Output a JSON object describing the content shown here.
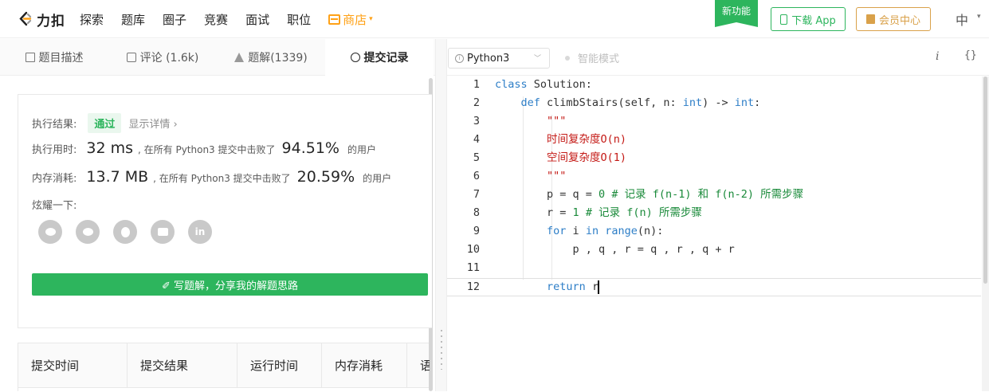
{
  "nav": {
    "logo_text": "力扣",
    "links": [
      "探索",
      "题库",
      "圈子",
      "竞赛",
      "面试",
      "职位"
    ],
    "shop": "商店",
    "new_feature": "新功能",
    "download_app": "下载 App",
    "vip": "会员中心",
    "lang": "中"
  },
  "left_tabs": [
    {
      "label": "题目描述",
      "icon": "description-icon"
    },
    {
      "label": "评论 (1.6k)",
      "icon": "comment-icon"
    },
    {
      "label": "题解(1339)",
      "icon": "flask-icon"
    },
    {
      "label": "提交记录",
      "icon": "clock-icon",
      "active": true
    }
  ],
  "result": {
    "status_label": "执行结果:",
    "status": "通过",
    "detail": "显示详情 ›",
    "runtime_label": "执行用时:",
    "runtime": "32 ms",
    "runtime_mid": ", 在所有 Python3 提交中击败了",
    "runtime_pct": "94.51%",
    "runtime_tail": "的用户",
    "memory_label": "内存消耗:",
    "memory": "13.7 MB",
    "memory_mid": ", 在所有 Python3 提交中击败了",
    "memory_pct": "20.59%",
    "memory_tail": "的用户",
    "share_label": "炫耀一下:",
    "share_icons": [
      "wechat-icon",
      "weibo-icon",
      "qq-icon",
      "douban-icon",
      "linkedin-icon"
    ],
    "linkedin_text": "in",
    "write_solution": "✐ 写题解，分享我的解题思路"
  },
  "table": {
    "headers": [
      "提交时间",
      "提交结果",
      "运行时间",
      "内存消耗",
      "语"
    ]
  },
  "editor": {
    "language": "Python3",
    "smart_mode": "智能模式",
    "tool_italic": "i",
    "tool_braces": "{}",
    "line_numbers": [
      "1",
      "2",
      "3",
      "4",
      "5",
      "6",
      "7",
      "8",
      "9",
      "10",
      "11",
      "12"
    ],
    "code": [
      {
        "parts": [
          [
            "kw",
            "class"
          ],
          [
            "",
            " Solution:"
          ]
        ]
      },
      {
        "parts": [
          [
            "",
            "    "
          ],
          [
            "kw",
            "def"
          ],
          [
            "",
            " climbStairs(self, n: "
          ],
          [
            "kw",
            "int"
          ],
          [
            "",
            ") -> "
          ],
          [
            "kw",
            "int"
          ],
          [
            "",
            ":"
          ]
        ]
      },
      {
        "parts": [
          [
            "",
            "        "
          ],
          [
            "str",
            "\"\"\""
          ]
        ]
      },
      {
        "parts": [
          [
            "",
            "        "
          ],
          [
            "str",
            "时间复杂度O(n)"
          ]
        ]
      },
      {
        "parts": [
          [
            "",
            "        "
          ],
          [
            "str",
            "空间复杂度O(1)"
          ]
        ]
      },
      {
        "parts": [
          [
            "",
            "        "
          ],
          [
            "str",
            "\"\"\""
          ]
        ]
      },
      {
        "parts": [
          [
            "",
            "        p = q = "
          ],
          [
            "num",
            "0"
          ],
          [
            "kg",
            " # 记录 f(n-1) 和 f(n-2) 所需步骤"
          ]
        ]
      },
      {
        "parts": [
          [
            "",
            "        r = "
          ],
          [
            "num",
            "1"
          ],
          [
            "kg",
            " # 记录 f(n) 所需步骤"
          ]
        ]
      },
      {
        "parts": [
          [
            "",
            "        "
          ],
          [
            "kw",
            "for"
          ],
          [
            "",
            " i "
          ],
          [
            "kw",
            "in"
          ],
          [
            "",
            " "
          ],
          [
            "kw",
            "range"
          ],
          [
            "",
            "(n):"
          ]
        ]
      },
      {
        "parts": [
          [
            "",
            "            p , q , r = q , r , q + r"
          ]
        ]
      },
      {
        "parts": [
          [
            "",
            ""
          ]
        ]
      },
      {
        "parts": [
          [
            "",
            "        "
          ],
          [
            "kw",
            "return"
          ],
          [
            "",
            " r"
          ]
        ]
      }
    ]
  },
  "colors": {
    "brand_green": "#2db55d",
    "shop_orange": "#ffa116",
    "vip_gold": "#d9a14a"
  }
}
